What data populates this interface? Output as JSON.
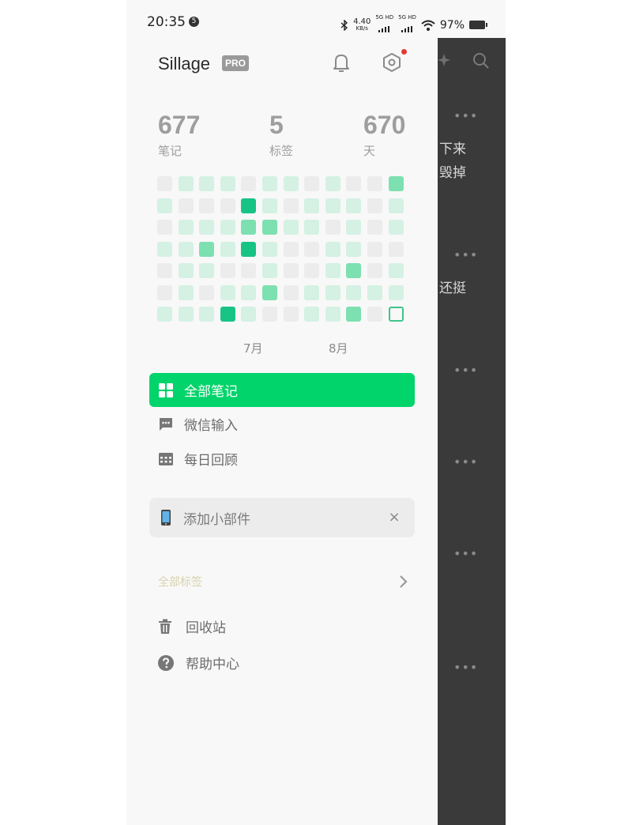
{
  "status_bar": {
    "time": "20:35",
    "notification_count": "5",
    "net_speed": "4.40",
    "net_unit": "KB/s",
    "sim1": "5G HD",
    "sim2": "5G HD",
    "battery": "97%"
  },
  "drawer": {
    "app_name": "Sillage",
    "pro_badge": "PRO",
    "stats": [
      {
        "value": "677",
        "label": "笔记"
      },
      {
        "value": "5",
        "label": "标签"
      },
      {
        "value": "670",
        "label": "天"
      }
    ],
    "heatmap": {
      "rows": [
        [
          0,
          1,
          1,
          1,
          0,
          1,
          1,
          0,
          1,
          0,
          0,
          2
        ],
        [
          1,
          0,
          0,
          0,
          3,
          1,
          0,
          1,
          1,
          1,
          0,
          1
        ],
        [
          0,
          1,
          1,
          1,
          2,
          2,
          1,
          1,
          0,
          1,
          0,
          1
        ],
        [
          1,
          1,
          2,
          1,
          3,
          1,
          0,
          0,
          1,
          1,
          0,
          0
        ],
        [
          0,
          1,
          1,
          0,
          0,
          1,
          0,
          0,
          1,
          2,
          0,
          1
        ],
        [
          0,
          1,
          0,
          1,
          1,
          2,
          0,
          1,
          1,
          1,
          1,
          1
        ],
        [
          1,
          1,
          1,
          3,
          1,
          0,
          0,
          1,
          1,
          2,
          0,
          4
        ]
      ],
      "months": [
        "7月",
        "8月"
      ]
    },
    "nav": [
      {
        "label": "全部笔记",
        "icon": "grid-icon",
        "active": true
      },
      {
        "label": "微信输入",
        "icon": "chat-icon",
        "active": false
      },
      {
        "label": "每日回顾",
        "icon": "calendar-icon",
        "active": false
      }
    ],
    "widget_prompt": {
      "label": "添加小部件",
      "icon": "phone-icon",
      "close": "×"
    },
    "tags_section": {
      "label": "全部标签",
      "icon": "chevron-right-icon"
    },
    "footer": [
      {
        "label": "回收站",
        "icon": "trash-icon"
      },
      {
        "label": "帮助中心",
        "icon": "help-icon"
      }
    ]
  },
  "background_list": {
    "more_glyph": "•••",
    "text_1": "下来",
    "text_2": "毁掉",
    "text_3": "还挺"
  },
  "colors": {
    "accent": "#00d46a",
    "heat_levels": [
      "#ececec",
      "#d4f1e3",
      "#7de0b0",
      "#17c486"
    ]
  }
}
